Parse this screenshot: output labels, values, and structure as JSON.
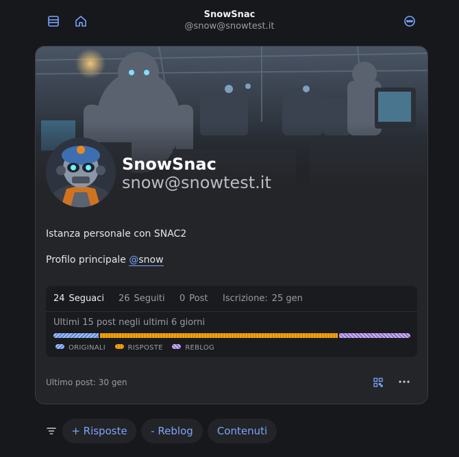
{
  "header": {
    "title": "SnowSnac",
    "subtitle": "@snow@snowtest.it",
    "icons": [
      "list-icon",
      "home-icon",
      "more-circle-icon"
    ]
  },
  "profile": {
    "display_name": "SnowSnac",
    "handle": "snow@snowtest.it",
    "bio_line1": "Istanza personale con SNAC2",
    "bio_line2_prefix": "Profilo principale",
    "mention_at": "@",
    "mention_user": "snow"
  },
  "stats": {
    "followers_count": "24",
    "followers_label": "Seguaci",
    "following_count": "26",
    "following_label": "Seguiti",
    "posts_count": "0",
    "posts_label": "Post",
    "joined_label": "Iscrizione:",
    "joined_value": "25 gen"
  },
  "activity": {
    "label": "Ultimi 15 post negli ultimi 6 giorni",
    "shares": {
      "originali": 0.13,
      "risposte": 0.67,
      "reblog": 0.2
    },
    "legend": [
      "ORIGINALI",
      "RISPOSTE",
      "REBLOG"
    ]
  },
  "footer": {
    "last_post": "Ultimo post: 30 gen"
  },
  "filters": {
    "replies": "+ Risposte",
    "reblog": "- Reblog",
    "contents": "Contenuti"
  },
  "colors": {
    "accent": "#7aa5ff",
    "originali": "#5b86d8",
    "risposte": "#f0a20c",
    "reblog": "#8e6cc9"
  }
}
